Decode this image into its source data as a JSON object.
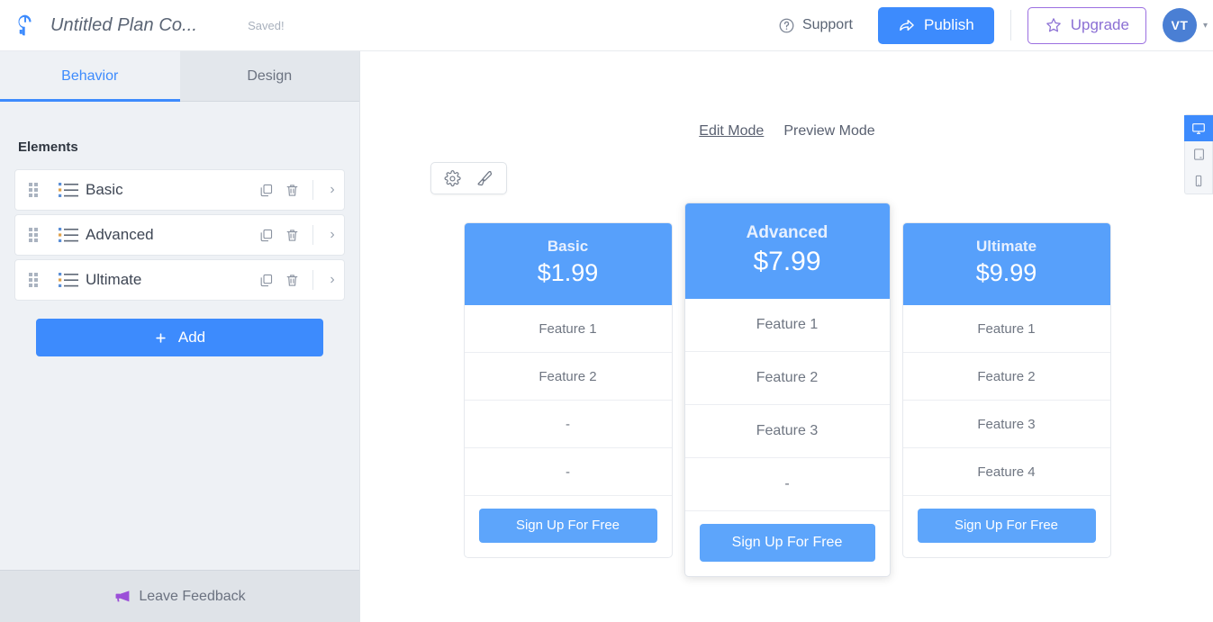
{
  "topbar": {
    "logo_icon": "wrench-power-logo",
    "doc_title": "Untitled Plan Co...",
    "saved_label": "Saved!",
    "support_label": "Support",
    "support_icon": "question-circle-icon",
    "publish_label": "Publish",
    "publish_icon": "share-arrow-icon",
    "upgrade_label": "Upgrade",
    "upgrade_icon": "star-icon",
    "avatar_initials": "VT",
    "caret_icon": "chevron-down-icon",
    "accent_blue": "#3d8bfd",
    "upgrade_purple": "#9b6fe0"
  },
  "sidebar": {
    "tabs": [
      {
        "label": "Behavior",
        "active": true
      },
      {
        "label": "Design",
        "active": false
      }
    ],
    "panel_title": "Elements",
    "elements": [
      {
        "label": "Basic",
        "list_icon": "list-icon",
        "drag_icon": "drag-handle-icon",
        "copy_icon": "copy-icon",
        "delete_icon": "trash-icon",
        "expand_icon": "chevron-right-icon"
      },
      {
        "label": "Advanced",
        "list_icon": "list-icon",
        "drag_icon": "drag-handle-icon",
        "copy_icon": "copy-icon",
        "delete_icon": "trash-icon",
        "expand_icon": "chevron-right-icon"
      },
      {
        "label": "Ultimate",
        "list_icon": "list-icon",
        "drag_icon": "drag-handle-icon",
        "copy_icon": "copy-icon",
        "delete_icon": "trash-icon",
        "expand_icon": "chevron-right-icon"
      }
    ],
    "add_label": "Add",
    "add_icon": "plus-icon",
    "feedback_label": "Leave Feedback",
    "feedback_icon": "megaphone-icon"
  },
  "canvas": {
    "modes": [
      {
        "label": "Edit Mode",
        "active": true
      },
      {
        "label": "Preview Mode",
        "active": false
      }
    ],
    "float_tools": [
      {
        "icon": "gear-icon"
      },
      {
        "icon": "paintbrush-icon"
      }
    ],
    "cards": [
      {
        "name": "Basic",
        "price": "$1.99",
        "featured": false,
        "features": [
          "Feature 1",
          "Feature 2",
          "-",
          "-"
        ],
        "cta": "Sign Up For Free"
      },
      {
        "name": "Advanced",
        "price": "$7.99",
        "featured": true,
        "features": [
          "Feature 1",
          "Feature 2",
          "Feature 3",
          "-"
        ],
        "cta": "Sign Up For Free"
      },
      {
        "name": "Ultimate",
        "price": "$9.99",
        "featured": false,
        "features": [
          "Feature 1",
          "Feature 2",
          "Feature 3",
          "Feature 4"
        ],
        "cta": "Sign Up For Free"
      }
    ],
    "card_header_color": "#57a0fb",
    "cta_color": "#5da5fb"
  },
  "devices": [
    {
      "icon": "desktop-icon",
      "active": true
    },
    {
      "icon": "tablet-icon",
      "active": false
    },
    {
      "icon": "mobile-icon",
      "active": false
    }
  ]
}
